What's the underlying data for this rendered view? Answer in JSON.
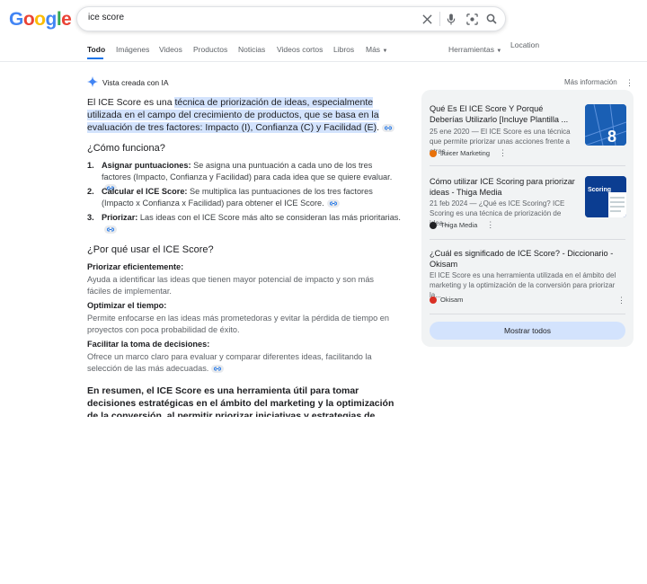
{
  "logo": {
    "letters": [
      "G",
      "o",
      "o",
      "g",
      "l",
      "e"
    ],
    "colors": [
      "#4285F4",
      "#EA4335",
      "#FBBC05",
      "#4285F4",
      "#34A853",
      "#EA4335"
    ]
  },
  "search": {
    "query": "ice score"
  },
  "tabs": [
    "Todo",
    "Imágenes",
    "Videos",
    "Productos",
    "Noticias",
    "Videos cortos",
    "Libros",
    "Más"
  ],
  "tools_label": "Herramientas",
  "location_label": "Location",
  "ai_overview": {
    "header": "Vista creada con IA",
    "more_info": "Más información",
    "intro_plain": "El ICE Score es una ",
    "intro_highlight": "técnica de priorización de ideas, especialmente utilizada en el campo del crecimiento de productos, que se basa en la evaluación de tres factores: Impacto (I), Confianza (C) y Facilidad (E)",
    "intro_end": ".",
    "how_title": "¿Cómo funciona?",
    "steps": [
      {
        "num": "1.",
        "bold": "Asignar puntuaciones:",
        "text": " Se asigna una puntuación a cada uno de los tres factores (Impacto, Confianza y Facilidad) para cada idea que se quiere evaluar."
      },
      {
        "num": "2.",
        "bold": "Calcular el ICE Score:",
        "text": " Se multiplica las puntuaciones de los tres factores (Impacto x Confianza x Facilidad) para obtener el ICE Score."
      },
      {
        "num": "3.",
        "bold": "Priorizar:",
        "text": " Las ideas con el ICE Score más alto se consideran las más prioritarias."
      }
    ],
    "why_title": "¿Por qué usar el ICE Score?",
    "reasons": [
      {
        "title": "Priorizar eficientemente:",
        "text": "Ayuda a identificar las ideas que tienen mayor potencial de impacto y son más fáciles de implementar."
      },
      {
        "title": "Optimizar el tiempo:",
        "text": "Permite enfocarse en las ideas más prometedoras y evitar la pérdida de tiempo en proyectos con poca probabilidad de éxito."
      },
      {
        "title": "Facilitar la toma de decisiones:",
        "text": "Ofrece un marco claro para evaluar y comparar diferentes ideas, facilitando la selección de las más adecuadas."
      }
    ],
    "summary": "En resumen, el ICE Score es una herramienta útil para tomar decisiones estratégicas en el ámbito del marketing y la optimización de la conversión, al permitir priorizar iniciativas y estrategias de crecimiento basadas en el"
  },
  "sources": [
    {
      "title": "Qué Es El ICE Score Y Porqué Deberías Utilizarlo [Incluye Plantilla ...",
      "desc": "25 ene 2020 — El ICE Score es una técnica que permite priorizar unas acciones frente a otras...",
      "source": "Juicer Marketing",
      "dot_color": "#e8710a",
      "thumb_text": "8"
    },
    {
      "title": "Cómo utilizar ICE Scoring para priorizar ideas - Thiga Media",
      "desc": "21 feb 2024 — ¿Qué es ICE Scoring? ICE Scoring es una técnica de priorización de idea...",
      "source": "Thiga Media",
      "dot_color": "#202124",
      "thumb_text": "Scoring"
    },
    {
      "title": "¿Cuál es significado de ICE Score? - Diccionario - Okisam",
      "desc": "El ICE Score es una herramienta utilizada en el ámbito del marketing y la optimización de la conversión para priorizar la...",
      "source": "Okisam",
      "dot_color": "#d93025"
    }
  ],
  "show_all": "Mostrar todos"
}
